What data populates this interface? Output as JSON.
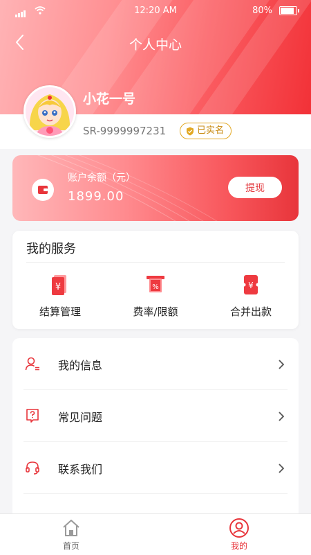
{
  "status_bar": {
    "time": "12:20 AM",
    "battery": "80%"
  },
  "header": {
    "title": "个人中心"
  },
  "profile": {
    "name": "小花一号",
    "account_id": "SR-9999997231",
    "verified_label": "已实名"
  },
  "balance": {
    "label": "账户余额（元）",
    "amount": "1899.00",
    "withdraw_label": "提现"
  },
  "services": {
    "title": "我的服务",
    "items": [
      {
        "label": "结算管理",
        "icon": "yuan-document-icon"
      },
      {
        "label": "费率/限额",
        "icon": "percent-icon"
      },
      {
        "label": "合并出款",
        "icon": "yuan-ticket-icon"
      }
    ]
  },
  "menu": {
    "items": [
      {
        "label": "我的信息",
        "icon": "user-info-icon"
      },
      {
        "label": "常见问题",
        "icon": "question-icon"
      },
      {
        "label": "联系我们",
        "icon": "headset-icon"
      }
    ]
  },
  "tabbar": {
    "items": [
      {
        "label": "首页",
        "icon": "home-icon",
        "active": false
      },
      {
        "label": "我的",
        "icon": "profile-icon",
        "active": true
      }
    ]
  },
  "colors": {
    "accent": "#e8353b",
    "verified": "#e2a823",
    "inactive_tab": "#9a9a9a"
  }
}
